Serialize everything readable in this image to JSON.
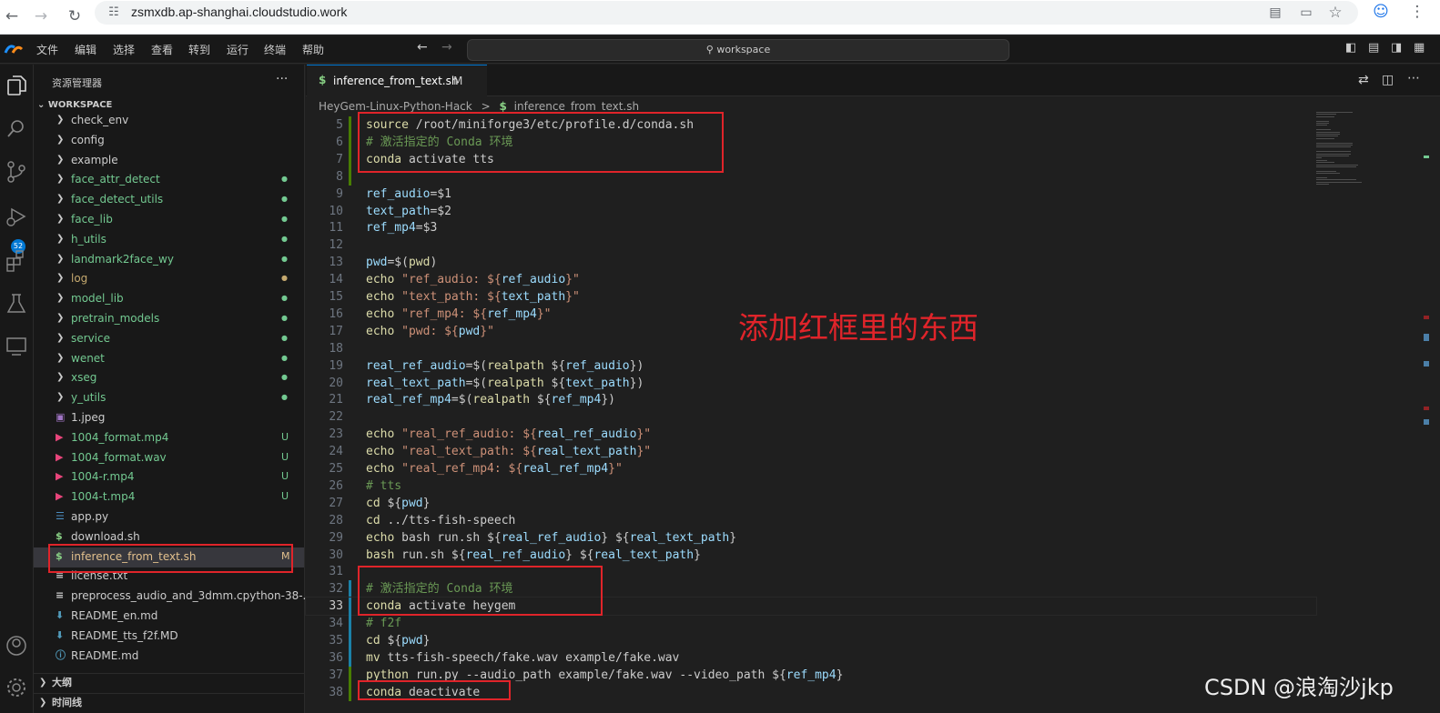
{
  "browser": {
    "url": "zsmxdb.ap-shanghai.cloudstudio.work"
  },
  "menubar": {
    "items": [
      "文件",
      "编辑",
      "选择",
      "查看",
      "转到",
      "运行",
      "终端",
      "帮助"
    ],
    "command_center": "workspace"
  },
  "activity_bar": {
    "scm_badge": "52"
  },
  "sidebar": {
    "title": "资源管理器",
    "more": "···",
    "workspace_label": "WORKSPACE",
    "items": [
      {
        "type": "folder",
        "label": "check_env",
        "color": "#cccccc",
        "deco": ""
      },
      {
        "type": "folder",
        "label": "config",
        "color": "#cccccc",
        "deco": ""
      },
      {
        "type": "folder",
        "label": "example",
        "color": "#cccccc",
        "deco": ""
      },
      {
        "type": "folder",
        "label": "face_attr_detect",
        "color": "#73c991",
        "deco": "●"
      },
      {
        "type": "folder",
        "label": "face_detect_utils",
        "color": "#73c991",
        "deco": "●"
      },
      {
        "type": "folder",
        "label": "face_lib",
        "color": "#73c991",
        "deco": "●"
      },
      {
        "type": "folder",
        "label": "h_utils",
        "color": "#73c991",
        "deco": "●"
      },
      {
        "type": "folder",
        "label": "landmark2face_wy",
        "color": "#73c991",
        "deco": "●"
      },
      {
        "type": "folder",
        "label": "log",
        "color": "#c5a96f",
        "deco": "●"
      },
      {
        "type": "folder",
        "label": "model_lib",
        "color": "#73c991",
        "deco": "●"
      },
      {
        "type": "folder",
        "label": "pretrain_models",
        "color": "#73c991",
        "deco": "●"
      },
      {
        "type": "folder",
        "label": "service",
        "color": "#73c991",
        "deco": "●"
      },
      {
        "type": "folder",
        "label": "wenet",
        "color": "#73c991",
        "deco": "●"
      },
      {
        "type": "folder",
        "label": "xseg",
        "color": "#73c991",
        "deco": "●"
      },
      {
        "type": "folder",
        "label": "y_utils",
        "color": "#73c991",
        "deco": "●"
      },
      {
        "type": "file",
        "icon": "image-icon",
        "label": "1.jpeg",
        "color": "#cccccc",
        "deco": ""
      },
      {
        "type": "file",
        "icon": "media-icon",
        "label": "1004_format.mp4",
        "color": "#73c991",
        "deco": "U"
      },
      {
        "type": "file",
        "icon": "media-icon",
        "label": "1004_format.wav",
        "color": "#73c991",
        "deco": "U"
      },
      {
        "type": "file",
        "icon": "media-icon",
        "label": "1004-r.mp4",
        "color": "#73c991",
        "deco": "U"
      },
      {
        "type": "file",
        "icon": "media-icon",
        "label": "1004-t.mp4",
        "color": "#73c991",
        "deco": "U"
      },
      {
        "type": "file",
        "icon": "python-icon",
        "label": "app.py",
        "color": "#cccccc",
        "deco": ""
      },
      {
        "type": "file",
        "icon": "shell-icon",
        "label": "download.sh",
        "color": "#cccccc",
        "deco": ""
      },
      {
        "type": "file",
        "icon": "shell-icon",
        "label": "inference_from_text.sh",
        "color": "#e2c08d",
        "deco": "M",
        "selected": true
      },
      {
        "type": "file",
        "icon": "text-icon",
        "label": "license.txt",
        "color": "#cccccc",
        "deco": ""
      },
      {
        "type": "file",
        "icon": "text-icon",
        "label": "preprocess_audio_and_3dmm.cpython-38-...",
        "color": "#cccccc",
        "deco": ""
      },
      {
        "type": "file",
        "icon": "markdown-icon",
        "label": "README_en.md",
        "color": "#cccccc",
        "deco": ""
      },
      {
        "type": "file",
        "icon": "markdown-icon",
        "label": "README_tts_f2f.MD",
        "color": "#cccccc",
        "deco": ""
      },
      {
        "type": "file",
        "icon": "info-icon",
        "label": "README.md",
        "color": "#cccccc",
        "deco": ""
      }
    ],
    "sections": [
      "大纲",
      "时间线"
    ]
  },
  "editor": {
    "tab_label": "inference_from_text.sh",
    "tab_modified": "M",
    "breadcrumb_folder": "HeyGem-Linux-Python-Hack",
    "breadcrumb_sep": ">",
    "breadcrumb_file": "inference_from_text.sh",
    "lines": [
      {
        "n": "5",
        "parts": [
          [
            "k",
            "source "
          ],
          [
            "d",
            "/root/miniforge3/etc/profile.d/conda.sh"
          ]
        ]
      },
      {
        "n": "6",
        "parts": [
          [
            "c",
            "# 激活指定的 Conda 环境"
          ]
        ]
      },
      {
        "n": "7",
        "parts": [
          [
            "k",
            "conda "
          ],
          [
            "d",
            "activate tts"
          ]
        ]
      },
      {
        "n": "8",
        "parts": []
      },
      {
        "n": "9",
        "parts": [
          [
            "v",
            "ref_audio"
          ],
          [
            "d",
            "=$1"
          ]
        ]
      },
      {
        "n": "10",
        "parts": [
          [
            "v",
            "text_path"
          ],
          [
            "d",
            "=$2"
          ]
        ]
      },
      {
        "n": "11",
        "parts": [
          [
            "v",
            "ref_mp4"
          ],
          [
            "d",
            "=$3"
          ]
        ]
      },
      {
        "n": "12",
        "parts": []
      },
      {
        "n": "13",
        "parts": [
          [
            "v",
            "pwd"
          ],
          [
            "d",
            "=$("
          ],
          [
            "k",
            "pwd"
          ],
          [
            "d",
            ")"
          ]
        ]
      },
      {
        "n": "14",
        "parts": [
          [
            "k",
            "echo "
          ],
          [
            "s",
            "\"ref_audio: ${"
          ],
          [
            "v",
            "ref_audio"
          ],
          [
            "s",
            "}\""
          ]
        ]
      },
      {
        "n": "15",
        "parts": [
          [
            "k",
            "echo "
          ],
          [
            "s",
            "\"text_path: ${"
          ],
          [
            "v",
            "text_path"
          ],
          [
            "s",
            "}\""
          ]
        ]
      },
      {
        "n": "16",
        "parts": [
          [
            "k",
            "echo "
          ],
          [
            "s",
            "\"ref_mp4: ${"
          ],
          [
            "v",
            "ref_mp4"
          ],
          [
            "s",
            "}\""
          ]
        ]
      },
      {
        "n": "17",
        "parts": [
          [
            "k",
            "echo "
          ],
          [
            "s",
            "\"pwd: ${"
          ],
          [
            "v",
            "pwd"
          ],
          [
            "s",
            "}\""
          ]
        ]
      },
      {
        "n": "18",
        "parts": []
      },
      {
        "n": "19",
        "parts": [
          [
            "v",
            "real_ref_audio"
          ],
          [
            "d",
            "=$("
          ],
          [
            "k",
            "realpath "
          ],
          [
            "d",
            "${"
          ],
          [
            "v",
            "ref_audio"
          ],
          [
            "d",
            "})"
          ]
        ]
      },
      {
        "n": "20",
        "parts": [
          [
            "v",
            "real_text_path"
          ],
          [
            "d",
            "=$("
          ],
          [
            "k",
            "realpath "
          ],
          [
            "d",
            "${"
          ],
          [
            "v",
            "text_path"
          ],
          [
            "d",
            "})"
          ]
        ]
      },
      {
        "n": "21",
        "parts": [
          [
            "v",
            "real_ref_mp4"
          ],
          [
            "d",
            "=$("
          ],
          [
            "k",
            "realpath "
          ],
          [
            "d",
            "${"
          ],
          [
            "v",
            "ref_mp4"
          ],
          [
            "d",
            "})"
          ]
        ]
      },
      {
        "n": "22",
        "parts": []
      },
      {
        "n": "23",
        "parts": [
          [
            "k",
            "echo "
          ],
          [
            "s",
            "\"real_ref_audio: ${"
          ],
          [
            "v",
            "real_ref_audio"
          ],
          [
            "s",
            "}\""
          ]
        ]
      },
      {
        "n": "24",
        "parts": [
          [
            "k",
            "echo "
          ],
          [
            "s",
            "\"real_text_path: ${"
          ],
          [
            "v",
            "real_text_path"
          ],
          [
            "s",
            "}\""
          ]
        ]
      },
      {
        "n": "25",
        "parts": [
          [
            "k",
            "echo "
          ],
          [
            "s",
            "\"real_ref_mp4: ${"
          ],
          [
            "v",
            "real_ref_mp4"
          ],
          [
            "s",
            "}\""
          ]
        ]
      },
      {
        "n": "26",
        "parts": [
          [
            "c",
            "# tts"
          ]
        ]
      },
      {
        "n": "27",
        "parts": [
          [
            "k",
            "cd "
          ],
          [
            "d",
            "${"
          ],
          [
            "v",
            "pwd"
          ],
          [
            "d",
            "}"
          ]
        ]
      },
      {
        "n": "28",
        "parts": [
          [
            "k",
            "cd "
          ],
          [
            "d",
            "../tts-fish-speech"
          ]
        ]
      },
      {
        "n": "29",
        "parts": [
          [
            "k",
            "echo "
          ],
          [
            "d",
            "bash run.sh ${"
          ],
          [
            "v",
            "real_ref_audio"
          ],
          [
            "d",
            "} ${"
          ],
          [
            "v",
            "real_text_path"
          ],
          [
            "d",
            "}"
          ]
        ]
      },
      {
        "n": "30",
        "parts": [
          [
            "k",
            "bash "
          ],
          [
            "d",
            "run.sh ${"
          ],
          [
            "v",
            "real_ref_audio"
          ],
          [
            "d",
            "} ${"
          ],
          [
            "v",
            "real_text_path"
          ],
          [
            "d",
            "}"
          ]
        ]
      },
      {
        "n": "31",
        "parts": []
      },
      {
        "n": "32",
        "parts": [
          [
            "c",
            "# 激活指定的 Conda 环境"
          ]
        ]
      },
      {
        "n": "33",
        "parts": [
          [
            "k",
            "conda "
          ],
          [
            "d",
            "activate heygem"
          ]
        ]
      },
      {
        "n": "34",
        "parts": [
          [
            "c",
            "# f2f"
          ]
        ]
      },
      {
        "n": "35",
        "parts": [
          [
            "k",
            "cd "
          ],
          [
            "d",
            "${"
          ],
          [
            "v",
            "pwd"
          ],
          [
            "d",
            "}"
          ]
        ]
      },
      {
        "n": "36",
        "parts": [
          [
            "k",
            "mv "
          ],
          [
            "d",
            "tts-fish-speech/fake.wav example/fake.wav"
          ]
        ]
      },
      {
        "n": "37",
        "parts": [
          [
            "k",
            "python "
          ],
          [
            "d",
            "run.py --audio_path example/fake.wav --video_path ${"
          ],
          [
            "v",
            "ref_mp4"
          ],
          [
            "d",
            "}"
          ]
        ]
      },
      {
        "n": "38",
        "parts": [
          [
            "k",
            "conda "
          ],
          [
            "d",
            "deactivate"
          ]
        ]
      }
    ]
  },
  "annotation": "添加红框里的东西",
  "watermark": "CSDN @浪淘沙jkp",
  "colors": {
    "accent": "#0078d4",
    "annotation_red": "#e0242a",
    "untracked_green": "#73c991",
    "modified_yellow": "#e2c08d"
  }
}
